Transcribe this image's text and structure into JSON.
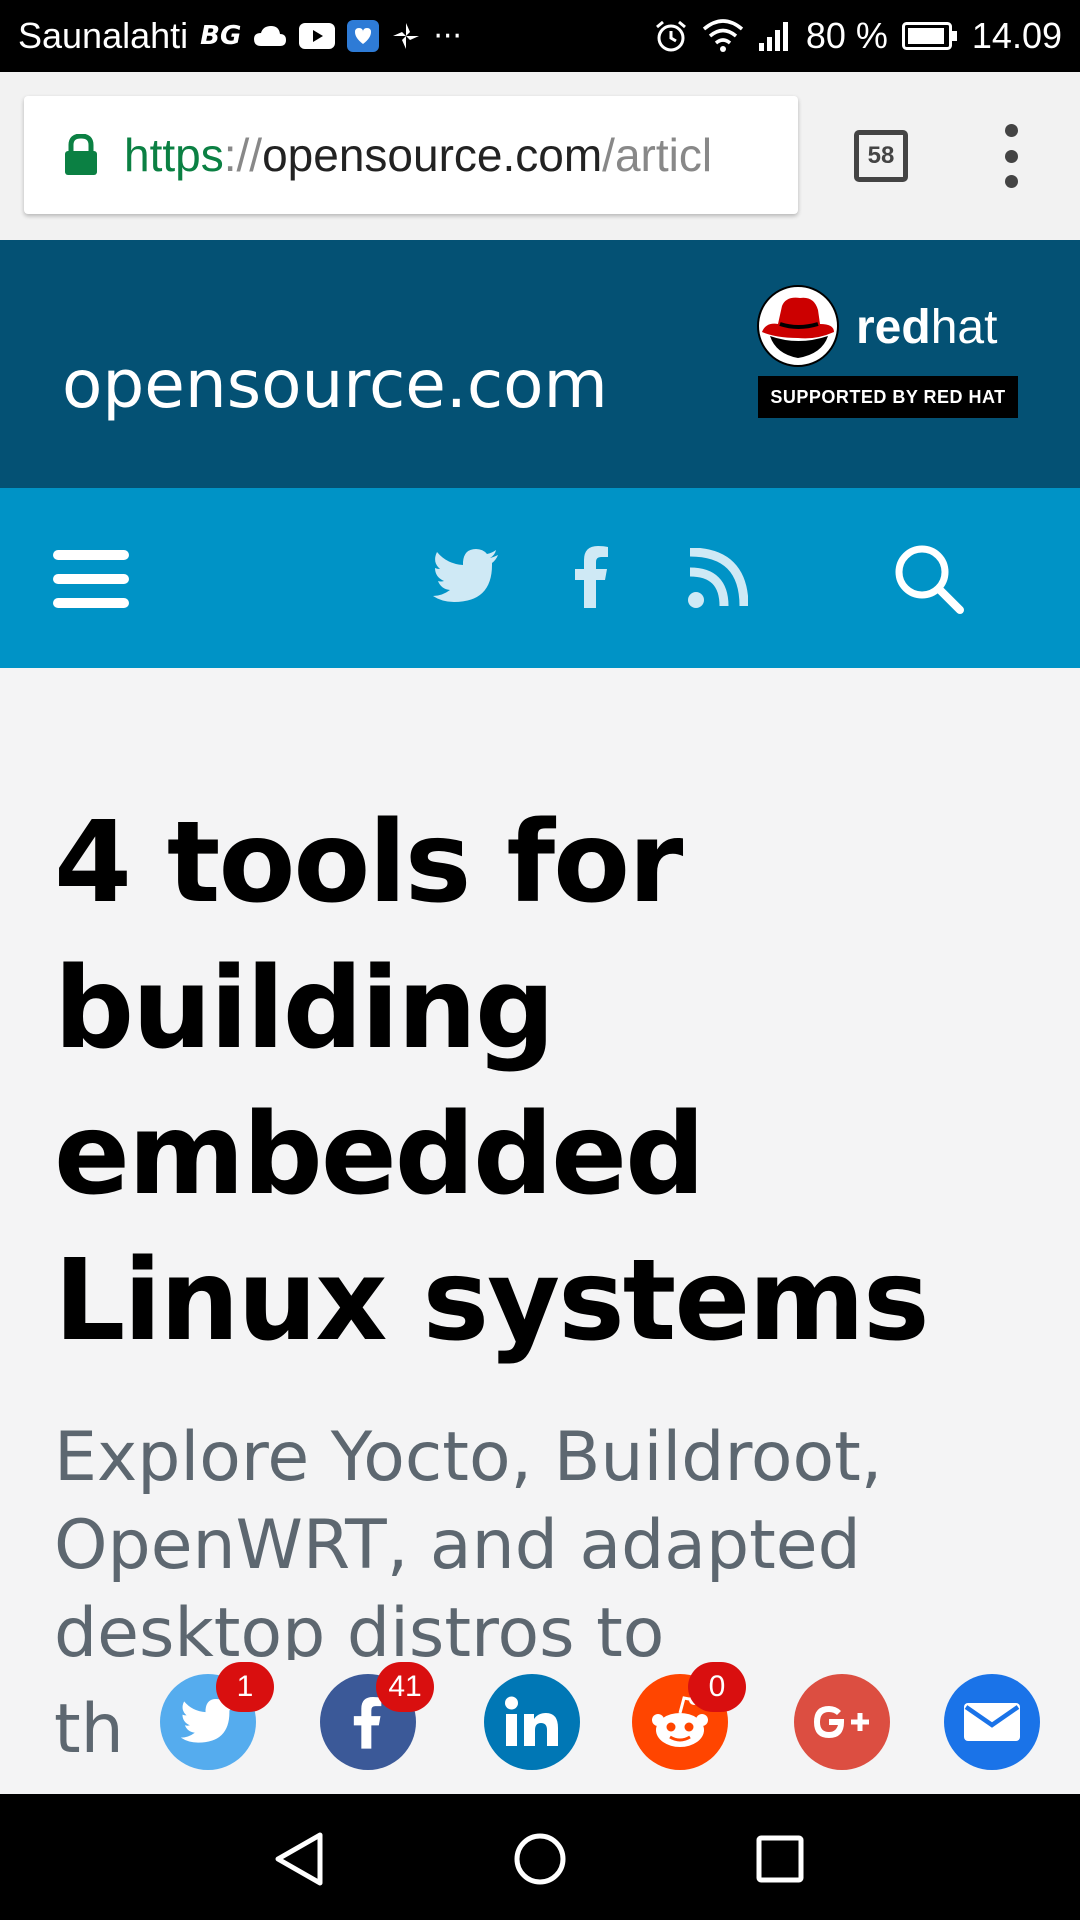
{
  "status_bar": {
    "carrier": "Saunalahti",
    "carrier_tag": "BG",
    "more": "···",
    "battery_percent": "80 %",
    "time": "14.09",
    "icons": [
      "cloud-icon",
      "youtube-icon",
      "messenger-icon",
      "pinwheel-icon",
      "alarm-icon",
      "wifi-icon",
      "signal-icon",
      "battery-icon"
    ]
  },
  "browser": {
    "url_scheme": "https",
    "url_sep": "://",
    "url_host": "opensource.com",
    "url_path": "/articl",
    "tab_count": "58"
  },
  "site": {
    "logo": "opensource.com",
    "sponsor_brand_bold": "red",
    "sponsor_brand_light": "hat",
    "sponsor_badge": "SUPPORTED BY RED HAT",
    "colors": {
      "header": "#045174",
      "nav": "#0093c6"
    }
  },
  "article": {
    "headline": "4 tools for building embedded Linux systems",
    "lede": "Explore Yocto, Buildroot, OpenWRT, and adapted desktop distros to determine th",
    "lede_visible_prefix": "th"
  },
  "share": {
    "twitter_count": "1",
    "facebook_count": "41",
    "reddit_count": "0",
    "colors": {
      "twitter": "#55acee",
      "facebook": "#3b5998",
      "linkedin": "#0077b5",
      "reddit": "#ff4500",
      "googleplus": "#dc4e41",
      "email": "#1a73e8"
    }
  }
}
